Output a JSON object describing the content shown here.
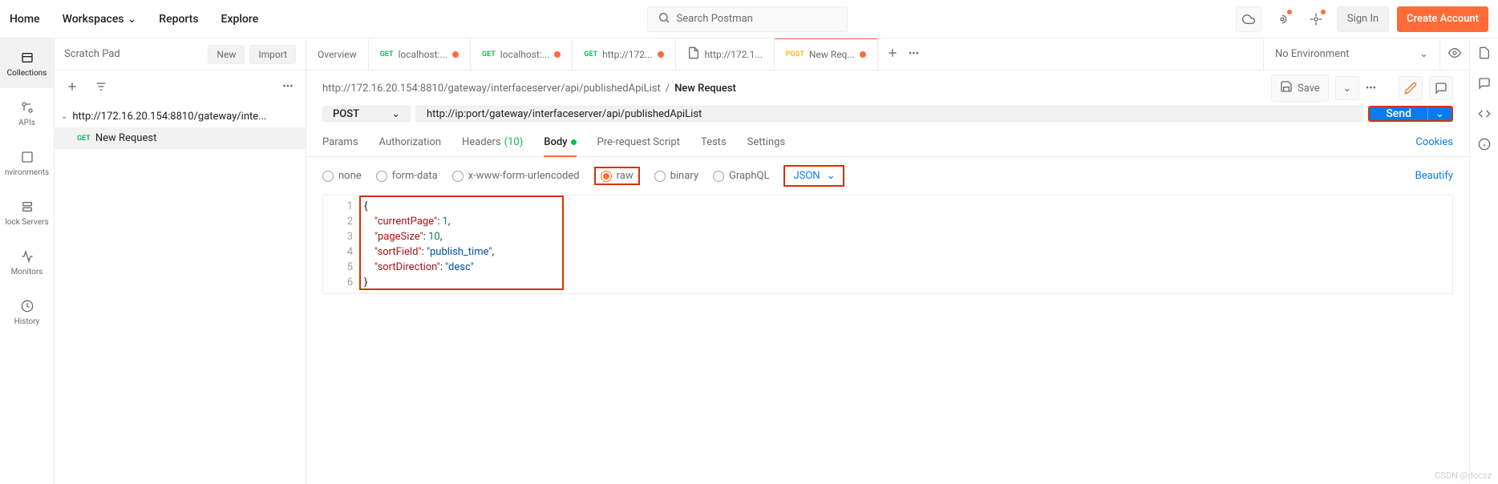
{
  "topnav": {
    "items": [
      "Home",
      "Workspaces",
      "Reports",
      "Explore"
    ],
    "search_placeholder": "Search Postman",
    "sign_in": "Sign In",
    "create_account": "Create Account"
  },
  "rail": {
    "items": [
      {
        "label": "Collections",
        "active": true
      },
      {
        "label": "APIs",
        "active": false
      },
      {
        "label": "nvironments",
        "active": false
      },
      {
        "label": "lock Servers",
        "active": false
      },
      {
        "label": "Monitors",
        "active": false
      },
      {
        "label": "History",
        "active": false
      }
    ]
  },
  "sidebar": {
    "title": "Scratch Pad",
    "new_label": "New",
    "import_label": "Import",
    "tree": {
      "collection": "http://172.16.20.154:8810/gateway/inte...",
      "request_method": "GET",
      "request_name": "New Request"
    }
  },
  "tabs": [
    {
      "type": "text",
      "label": "Overview",
      "dirty": false
    },
    {
      "type": "req",
      "method": "GET",
      "label": "localhost:...",
      "dirty": true
    },
    {
      "type": "req",
      "method": "GET",
      "label": "localhost:...",
      "dirty": true
    },
    {
      "type": "req",
      "method": "GET",
      "label": "http://172...",
      "dirty": true
    },
    {
      "type": "file",
      "label": "http://172.1...",
      "dirty": false
    },
    {
      "type": "req",
      "method": "POST",
      "label": "New Req...",
      "dirty": true,
      "active": true
    }
  ],
  "env": "No Environment",
  "breadcrumb": {
    "path": "http://172.16.20.154:8810/gateway/interfaceserver/api/publishedApiList",
    "current": "New Request"
  },
  "save_label": "Save",
  "request": {
    "method": "POST",
    "url": "http://ip:port/gateway/interfaceserver/api/publishedApiList",
    "send_label": "Send"
  },
  "req_tabs": {
    "params": "Params",
    "auth": "Authorization",
    "headers": "Headers",
    "headers_count": "(10)",
    "body": "Body",
    "prereq": "Pre-request Script",
    "tests": "Tests",
    "settings": "Settings",
    "cookies": "Cookies"
  },
  "body_types": {
    "none": "none",
    "form_data": "form-data",
    "urlencoded": "x-www-form-urlencoded",
    "raw": "raw",
    "binary": "binary",
    "graphql": "GraphQL",
    "format": "JSON",
    "beautify": "Beautify"
  },
  "editor": {
    "lines": [
      [
        {
          "t": "p",
          "v": "{"
        }
      ],
      [
        {
          "t": "p",
          "v": "    "
        },
        {
          "t": "k",
          "v": "\"currentPage\""
        },
        {
          "t": "p",
          "v": ": "
        },
        {
          "t": "n",
          "v": "1"
        },
        {
          "t": "p",
          "v": ","
        }
      ],
      [
        {
          "t": "p",
          "v": "    "
        },
        {
          "t": "k",
          "v": "\"pageSize\""
        },
        {
          "t": "p",
          "v": ": "
        },
        {
          "t": "n",
          "v": "10"
        },
        {
          "t": "p",
          "v": ","
        }
      ],
      [
        {
          "t": "p",
          "v": "    "
        },
        {
          "t": "k",
          "v": "\"sortField\""
        },
        {
          "t": "p",
          "v": ": "
        },
        {
          "t": "s",
          "v": "\"publish_time\""
        },
        {
          "t": "p",
          "v": ","
        }
      ],
      [
        {
          "t": "p",
          "v": "    "
        },
        {
          "t": "k",
          "v": "\"sortDirection\""
        },
        {
          "t": "p",
          "v": ": "
        },
        {
          "t": "s",
          "v": "\"desc\""
        }
      ],
      [
        {
          "t": "p",
          "v": "}"
        }
      ]
    ]
  },
  "watermark": "CSDN @docsz"
}
